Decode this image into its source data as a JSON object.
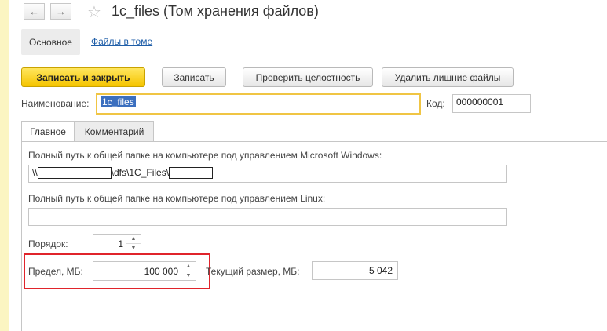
{
  "nav": {
    "back_icon": "←",
    "forward_icon": "→",
    "star_icon": "☆"
  },
  "title": "1c_files (Том хранения файлов)",
  "sections": {
    "main": "Основное",
    "files_link": "Файлы в томе"
  },
  "toolbar": {
    "save_close": "Записать и закрыть",
    "save": "Записать",
    "check": "Проверить целостность",
    "delete_extra": "Удалить лишние файлы"
  },
  "form": {
    "name_label": "Наименование:",
    "name_value": "1c_files",
    "code_label": "Код:",
    "code_value": "000000001"
  },
  "tabs": {
    "main": "Главное",
    "comment": "Комментарий"
  },
  "windows_path": {
    "label": "Полный путь к общей папке на компьютере под управлением Microsoft Windows:",
    "prefix": "\\\\",
    "middle": "\\dfs\\1C_Files\\"
  },
  "linux_path": {
    "label": "Полный путь к общей папке на компьютере под управлением Linux:",
    "value": ""
  },
  "order": {
    "label": "Порядок:",
    "value": "1"
  },
  "limit": {
    "label": "Предел, МБ:",
    "value": "100 000"
  },
  "current_size": {
    "label": "Текущий размер, МБ:",
    "value": "5 042"
  },
  "spin_icons": {
    "up": "▲",
    "down": "▼"
  },
  "colors": {
    "primary_button": "#f5c400",
    "highlight_frame": "#e0242b",
    "link": "#1f5ea8"
  }
}
